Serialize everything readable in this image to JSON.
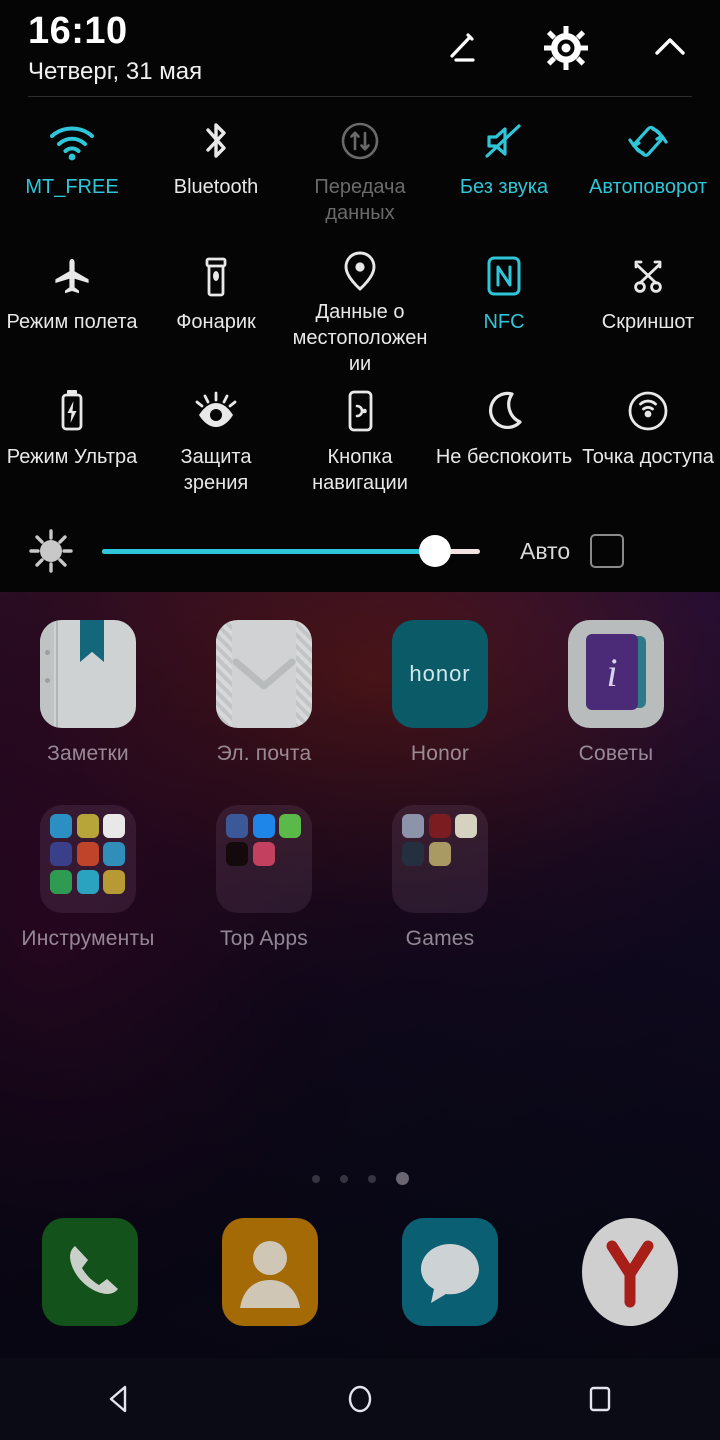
{
  "status_panel": {
    "time": "16:10",
    "date": "Четверг, 31 мая",
    "actions": [
      {
        "name": "edit-icon",
        "label": "Изменить"
      },
      {
        "name": "gear-icon",
        "label": "Настройки"
      },
      {
        "name": "chevron-up-icon",
        "label": "Свернуть"
      }
    ],
    "accent_color": "#2ec6d8",
    "inactive_color": "#e8e8e8",
    "disabled_color": "#6a6a6a",
    "tiles": [
      {
        "label": "MT_FREE",
        "icon": "wifi-icon",
        "state": "on"
      },
      {
        "label": "Bluetooth",
        "icon": "bluetooth-icon",
        "state": "off"
      },
      {
        "label": "Передача данных",
        "icon": "mobile-data-icon",
        "state": "disabled"
      },
      {
        "label": "Без звука",
        "icon": "mute-icon",
        "state": "on"
      },
      {
        "label": "Автоповорот",
        "icon": "auto-rotate-icon",
        "state": "on"
      },
      {
        "label": "Режим полета",
        "icon": "airplane-icon",
        "state": "off"
      },
      {
        "label": "Фонарик",
        "icon": "flashlight-icon",
        "state": "off"
      },
      {
        "label": "Данные о местоположении",
        "icon": "location-pin-icon",
        "state": "off"
      },
      {
        "label": "NFC",
        "icon": "nfc-icon",
        "state": "on"
      },
      {
        "label": "Скриншот",
        "icon": "scissors-icon",
        "state": "off"
      },
      {
        "label": "Режим Ультра",
        "icon": "battery-saver-icon",
        "state": "off"
      },
      {
        "label": "Защита зрения",
        "icon": "eye-comfort-icon",
        "state": "off"
      },
      {
        "label": "Кнопка навигации",
        "icon": "nav-button-icon",
        "state": "off"
      },
      {
        "label": "Не беспокоить",
        "icon": "moon-icon",
        "state": "off"
      },
      {
        "label": "Точка доступа",
        "icon": "hotspot-icon",
        "state": "off"
      }
    ],
    "brightness": {
      "icon": "brightness-sun-icon",
      "value_percent": 88,
      "auto_label": "Авто",
      "auto_checked": false
    }
  },
  "home_screen": {
    "apps_row1": [
      {
        "label": "Заметки",
        "icon": "notes-app-icon"
      },
      {
        "label": "Эл. почта",
        "icon": "email-app-icon"
      },
      {
        "label": "Honor",
        "icon": "honor-app-icon"
      },
      {
        "label": "Советы",
        "icon": "tips-app-icon"
      }
    ],
    "folders_row2": [
      {
        "label": "Инструменты",
        "icon": "folder-icon"
      },
      {
        "label": "Top Apps",
        "icon": "folder-icon"
      },
      {
        "label": "Games",
        "icon": "folder-icon"
      }
    ],
    "page_indicator": {
      "total": 4,
      "active": 4
    },
    "dock": [
      {
        "label": "Телефон",
        "icon": "phone-app-icon"
      },
      {
        "label": "Контакты",
        "icon": "contacts-app-icon"
      },
      {
        "label": "Сообщения",
        "icon": "messages-app-icon"
      },
      {
        "label": "Яндекс",
        "icon": "yandex-browser-app-icon"
      }
    ]
  },
  "navigation_bar": [
    {
      "name": "back-button",
      "icon": "back-triangle-icon"
    },
    {
      "name": "home-button",
      "icon": "home-circle-icon"
    },
    {
      "name": "recents-button",
      "icon": "recents-square-icon"
    }
  ]
}
